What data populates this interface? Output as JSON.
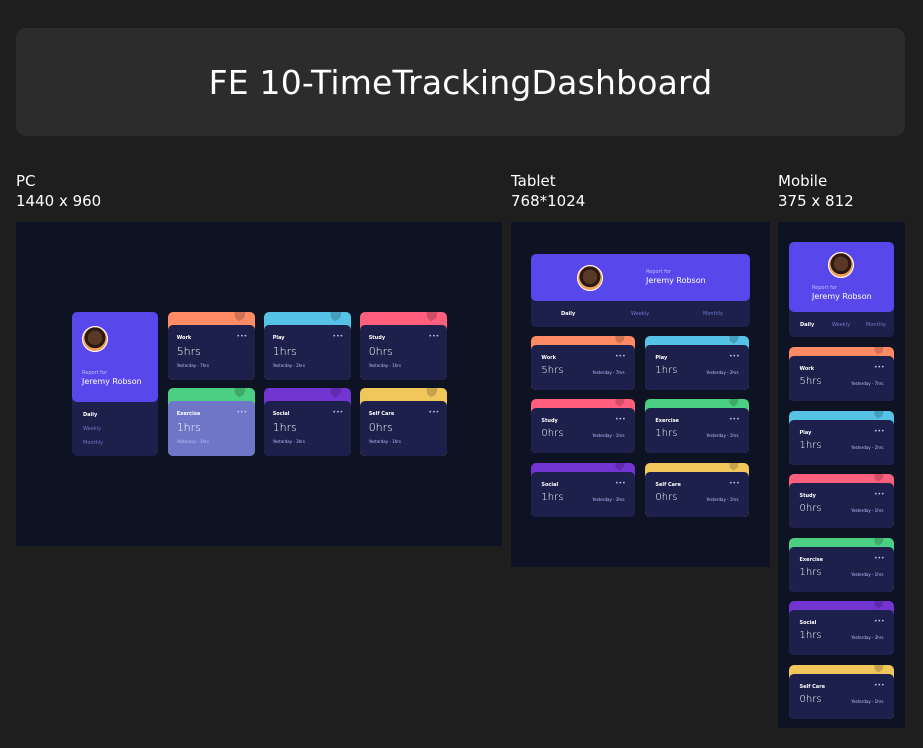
{
  "title": "FE 10-TimeTrackingDashboard",
  "sections": {
    "pc": {
      "label": "PC",
      "dims": "1440 x 960"
    },
    "tablet": {
      "label": "Tablet",
      "dims": "768*1024"
    },
    "mobile": {
      "label": "Mobile",
      "dims": "375 x 812"
    }
  },
  "profile": {
    "report_for": "Report for",
    "name": "Jeremy Robson"
  },
  "periods": [
    "Daily",
    "Weekly",
    "Monthly"
  ],
  "active_period": "Daily",
  "more_glyph": "•••",
  "cards": [
    {
      "title": "Work",
      "hours": "5hrs",
      "previous": "Yesterday - 7hrs",
      "color": "#ff8b64",
      "icon": "briefcase-icon"
    },
    {
      "title": "Play",
      "hours": "1hrs",
      "previous": "Yesterday - 2hrs",
      "color": "#55c2e6",
      "icon": "gamepad-icon"
    },
    {
      "title": "Study",
      "hours": "0hrs",
      "previous": "Yesterday - 1hrs",
      "color": "#ff5e7d",
      "icon": "book-icon"
    },
    {
      "title": "Exercise",
      "hours": "1hrs",
      "previous": "Yesterday - 1hrs",
      "color": "#4bcf82",
      "icon": "running-icon"
    },
    {
      "title": "Social",
      "hours": "1hrs",
      "previous": "Yesterday - 3hrs",
      "color": "#7335d2",
      "icon": "chat-icon"
    },
    {
      "title": "Self Care",
      "hours": "0hrs",
      "previous": "Yesterday - 1hrs",
      "color": "#f1c75b",
      "icon": "heart-icon"
    }
  ],
  "colors": {
    "accent": "#5847eb",
    "card_bg": "#1c204b",
    "frame_bg": "#0d1323",
    "hover_card": "#6f76c8"
  }
}
